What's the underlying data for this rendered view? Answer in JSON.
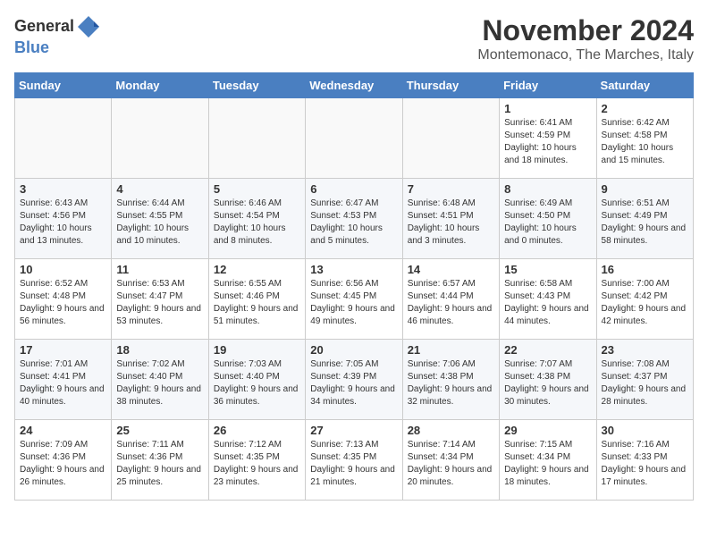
{
  "header": {
    "logo_general": "General",
    "logo_blue": "Blue",
    "month_title": "November 2024",
    "location": "Montemonaco, The Marches, Italy"
  },
  "days_of_week": [
    "Sunday",
    "Monday",
    "Tuesday",
    "Wednesday",
    "Thursday",
    "Friday",
    "Saturday"
  ],
  "weeks": [
    [
      {
        "day": "",
        "content": ""
      },
      {
        "day": "",
        "content": ""
      },
      {
        "day": "",
        "content": ""
      },
      {
        "day": "",
        "content": ""
      },
      {
        "day": "",
        "content": ""
      },
      {
        "day": "1",
        "content": "Sunrise: 6:41 AM\nSunset: 4:59 PM\nDaylight: 10 hours and 18 minutes."
      },
      {
        "day": "2",
        "content": "Sunrise: 6:42 AM\nSunset: 4:58 PM\nDaylight: 10 hours and 15 minutes."
      }
    ],
    [
      {
        "day": "3",
        "content": "Sunrise: 6:43 AM\nSunset: 4:56 PM\nDaylight: 10 hours and 13 minutes."
      },
      {
        "day": "4",
        "content": "Sunrise: 6:44 AM\nSunset: 4:55 PM\nDaylight: 10 hours and 10 minutes."
      },
      {
        "day": "5",
        "content": "Sunrise: 6:46 AM\nSunset: 4:54 PM\nDaylight: 10 hours and 8 minutes."
      },
      {
        "day": "6",
        "content": "Sunrise: 6:47 AM\nSunset: 4:53 PM\nDaylight: 10 hours and 5 minutes."
      },
      {
        "day": "7",
        "content": "Sunrise: 6:48 AM\nSunset: 4:51 PM\nDaylight: 10 hours and 3 minutes."
      },
      {
        "day": "8",
        "content": "Sunrise: 6:49 AM\nSunset: 4:50 PM\nDaylight: 10 hours and 0 minutes."
      },
      {
        "day": "9",
        "content": "Sunrise: 6:51 AM\nSunset: 4:49 PM\nDaylight: 9 hours and 58 minutes."
      }
    ],
    [
      {
        "day": "10",
        "content": "Sunrise: 6:52 AM\nSunset: 4:48 PM\nDaylight: 9 hours and 56 minutes."
      },
      {
        "day": "11",
        "content": "Sunrise: 6:53 AM\nSunset: 4:47 PM\nDaylight: 9 hours and 53 minutes."
      },
      {
        "day": "12",
        "content": "Sunrise: 6:55 AM\nSunset: 4:46 PM\nDaylight: 9 hours and 51 minutes."
      },
      {
        "day": "13",
        "content": "Sunrise: 6:56 AM\nSunset: 4:45 PM\nDaylight: 9 hours and 49 minutes."
      },
      {
        "day": "14",
        "content": "Sunrise: 6:57 AM\nSunset: 4:44 PM\nDaylight: 9 hours and 46 minutes."
      },
      {
        "day": "15",
        "content": "Sunrise: 6:58 AM\nSunset: 4:43 PM\nDaylight: 9 hours and 44 minutes."
      },
      {
        "day": "16",
        "content": "Sunrise: 7:00 AM\nSunset: 4:42 PM\nDaylight: 9 hours and 42 minutes."
      }
    ],
    [
      {
        "day": "17",
        "content": "Sunrise: 7:01 AM\nSunset: 4:41 PM\nDaylight: 9 hours and 40 minutes."
      },
      {
        "day": "18",
        "content": "Sunrise: 7:02 AM\nSunset: 4:40 PM\nDaylight: 9 hours and 38 minutes."
      },
      {
        "day": "19",
        "content": "Sunrise: 7:03 AM\nSunset: 4:40 PM\nDaylight: 9 hours and 36 minutes."
      },
      {
        "day": "20",
        "content": "Sunrise: 7:05 AM\nSunset: 4:39 PM\nDaylight: 9 hours and 34 minutes."
      },
      {
        "day": "21",
        "content": "Sunrise: 7:06 AM\nSunset: 4:38 PM\nDaylight: 9 hours and 32 minutes."
      },
      {
        "day": "22",
        "content": "Sunrise: 7:07 AM\nSunset: 4:38 PM\nDaylight: 9 hours and 30 minutes."
      },
      {
        "day": "23",
        "content": "Sunrise: 7:08 AM\nSunset: 4:37 PM\nDaylight: 9 hours and 28 minutes."
      }
    ],
    [
      {
        "day": "24",
        "content": "Sunrise: 7:09 AM\nSunset: 4:36 PM\nDaylight: 9 hours and 26 minutes."
      },
      {
        "day": "25",
        "content": "Sunrise: 7:11 AM\nSunset: 4:36 PM\nDaylight: 9 hours and 25 minutes."
      },
      {
        "day": "26",
        "content": "Sunrise: 7:12 AM\nSunset: 4:35 PM\nDaylight: 9 hours and 23 minutes."
      },
      {
        "day": "27",
        "content": "Sunrise: 7:13 AM\nSunset: 4:35 PM\nDaylight: 9 hours and 21 minutes."
      },
      {
        "day": "28",
        "content": "Sunrise: 7:14 AM\nSunset: 4:34 PM\nDaylight: 9 hours and 20 minutes."
      },
      {
        "day": "29",
        "content": "Sunrise: 7:15 AM\nSunset: 4:34 PM\nDaylight: 9 hours and 18 minutes."
      },
      {
        "day": "30",
        "content": "Sunrise: 7:16 AM\nSunset: 4:33 PM\nDaylight: 9 hours and 17 minutes."
      }
    ]
  ]
}
